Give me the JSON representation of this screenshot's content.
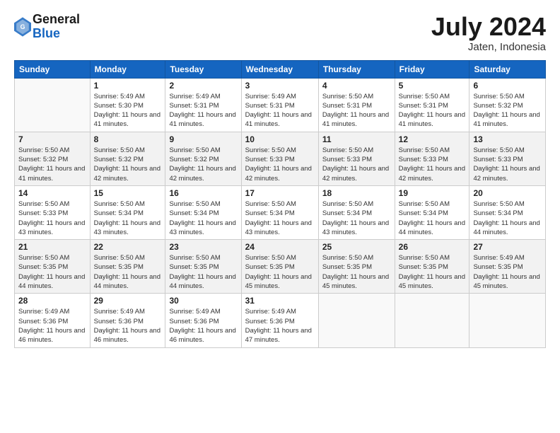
{
  "header": {
    "logo_general": "General",
    "logo_blue": "Blue",
    "month_year": "July 2024",
    "location": "Jaten, Indonesia"
  },
  "days_of_week": [
    "Sunday",
    "Monday",
    "Tuesday",
    "Wednesday",
    "Thursday",
    "Friday",
    "Saturday"
  ],
  "weeks": [
    [
      {
        "day": "",
        "empty": true
      },
      {
        "day": "1",
        "sunrise": "Sunrise: 5:49 AM",
        "sunset": "Sunset: 5:30 PM",
        "daylight": "Daylight: 11 hours and 41 minutes."
      },
      {
        "day": "2",
        "sunrise": "Sunrise: 5:49 AM",
        "sunset": "Sunset: 5:31 PM",
        "daylight": "Daylight: 11 hours and 41 minutes."
      },
      {
        "day": "3",
        "sunrise": "Sunrise: 5:49 AM",
        "sunset": "Sunset: 5:31 PM",
        "daylight": "Daylight: 11 hours and 41 minutes."
      },
      {
        "day": "4",
        "sunrise": "Sunrise: 5:50 AM",
        "sunset": "Sunset: 5:31 PM",
        "daylight": "Daylight: 11 hours and 41 minutes."
      },
      {
        "day": "5",
        "sunrise": "Sunrise: 5:50 AM",
        "sunset": "Sunset: 5:31 PM",
        "daylight": "Daylight: 11 hours and 41 minutes."
      },
      {
        "day": "6",
        "sunrise": "Sunrise: 5:50 AM",
        "sunset": "Sunset: 5:32 PM",
        "daylight": "Daylight: 11 hours and 41 minutes."
      }
    ],
    [
      {
        "day": "7",
        "sunrise": "Sunrise: 5:50 AM",
        "sunset": "Sunset: 5:32 PM",
        "daylight": "Daylight: 11 hours and 41 minutes."
      },
      {
        "day": "8",
        "sunrise": "Sunrise: 5:50 AM",
        "sunset": "Sunset: 5:32 PM",
        "daylight": "Daylight: 11 hours and 42 minutes."
      },
      {
        "day": "9",
        "sunrise": "Sunrise: 5:50 AM",
        "sunset": "Sunset: 5:32 PM",
        "daylight": "Daylight: 11 hours and 42 minutes."
      },
      {
        "day": "10",
        "sunrise": "Sunrise: 5:50 AM",
        "sunset": "Sunset: 5:33 PM",
        "daylight": "Daylight: 11 hours and 42 minutes."
      },
      {
        "day": "11",
        "sunrise": "Sunrise: 5:50 AM",
        "sunset": "Sunset: 5:33 PM",
        "daylight": "Daylight: 11 hours and 42 minutes."
      },
      {
        "day": "12",
        "sunrise": "Sunrise: 5:50 AM",
        "sunset": "Sunset: 5:33 PM",
        "daylight": "Daylight: 11 hours and 42 minutes."
      },
      {
        "day": "13",
        "sunrise": "Sunrise: 5:50 AM",
        "sunset": "Sunset: 5:33 PM",
        "daylight": "Daylight: 11 hours and 42 minutes."
      }
    ],
    [
      {
        "day": "14",
        "sunrise": "Sunrise: 5:50 AM",
        "sunset": "Sunset: 5:33 PM",
        "daylight": "Daylight: 11 hours and 43 minutes."
      },
      {
        "day": "15",
        "sunrise": "Sunrise: 5:50 AM",
        "sunset": "Sunset: 5:34 PM",
        "daylight": "Daylight: 11 hours and 43 minutes."
      },
      {
        "day": "16",
        "sunrise": "Sunrise: 5:50 AM",
        "sunset": "Sunset: 5:34 PM",
        "daylight": "Daylight: 11 hours and 43 minutes."
      },
      {
        "day": "17",
        "sunrise": "Sunrise: 5:50 AM",
        "sunset": "Sunset: 5:34 PM",
        "daylight": "Daylight: 11 hours and 43 minutes."
      },
      {
        "day": "18",
        "sunrise": "Sunrise: 5:50 AM",
        "sunset": "Sunset: 5:34 PM",
        "daylight": "Daylight: 11 hours and 43 minutes."
      },
      {
        "day": "19",
        "sunrise": "Sunrise: 5:50 AM",
        "sunset": "Sunset: 5:34 PM",
        "daylight": "Daylight: 11 hours and 44 minutes."
      },
      {
        "day": "20",
        "sunrise": "Sunrise: 5:50 AM",
        "sunset": "Sunset: 5:34 PM",
        "daylight": "Daylight: 11 hours and 44 minutes."
      }
    ],
    [
      {
        "day": "21",
        "sunrise": "Sunrise: 5:50 AM",
        "sunset": "Sunset: 5:35 PM",
        "daylight": "Daylight: 11 hours and 44 minutes."
      },
      {
        "day": "22",
        "sunrise": "Sunrise: 5:50 AM",
        "sunset": "Sunset: 5:35 PM",
        "daylight": "Daylight: 11 hours and 44 minutes."
      },
      {
        "day": "23",
        "sunrise": "Sunrise: 5:50 AM",
        "sunset": "Sunset: 5:35 PM",
        "daylight": "Daylight: 11 hours and 44 minutes."
      },
      {
        "day": "24",
        "sunrise": "Sunrise: 5:50 AM",
        "sunset": "Sunset: 5:35 PM",
        "daylight": "Daylight: 11 hours and 45 minutes."
      },
      {
        "day": "25",
        "sunrise": "Sunrise: 5:50 AM",
        "sunset": "Sunset: 5:35 PM",
        "daylight": "Daylight: 11 hours and 45 minutes."
      },
      {
        "day": "26",
        "sunrise": "Sunrise: 5:50 AM",
        "sunset": "Sunset: 5:35 PM",
        "daylight": "Daylight: 11 hours and 45 minutes."
      },
      {
        "day": "27",
        "sunrise": "Sunrise: 5:49 AM",
        "sunset": "Sunset: 5:35 PM",
        "daylight": "Daylight: 11 hours and 45 minutes."
      }
    ],
    [
      {
        "day": "28",
        "sunrise": "Sunrise: 5:49 AM",
        "sunset": "Sunset: 5:36 PM",
        "daylight": "Daylight: 11 hours and 46 minutes."
      },
      {
        "day": "29",
        "sunrise": "Sunrise: 5:49 AM",
        "sunset": "Sunset: 5:36 PM",
        "daylight": "Daylight: 11 hours and 46 minutes."
      },
      {
        "day": "30",
        "sunrise": "Sunrise: 5:49 AM",
        "sunset": "Sunset: 5:36 PM",
        "daylight": "Daylight: 11 hours and 46 minutes."
      },
      {
        "day": "31",
        "sunrise": "Sunrise: 5:49 AM",
        "sunset": "Sunset: 5:36 PM",
        "daylight": "Daylight: 11 hours and 47 minutes."
      },
      {
        "day": "",
        "empty": true
      },
      {
        "day": "",
        "empty": true
      },
      {
        "day": "",
        "empty": true
      }
    ]
  ]
}
